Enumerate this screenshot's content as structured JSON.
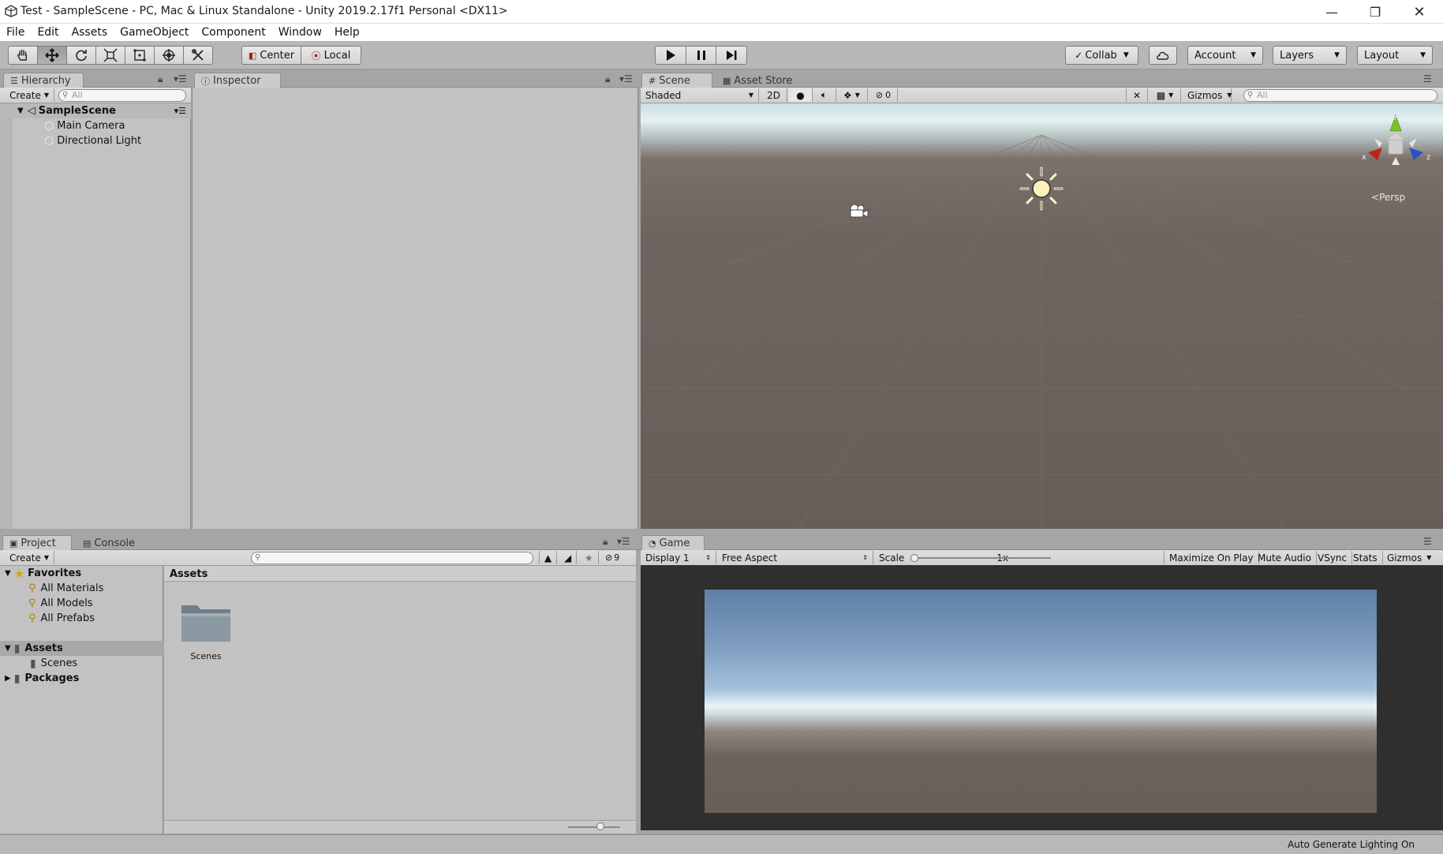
{
  "window": {
    "title": "Test - SampleScene - PC, Mac & Linux Standalone - Unity 2019.2.17f1 Personal <DX11>"
  },
  "menu": [
    "File",
    "Edit",
    "Assets",
    "GameObject",
    "Component",
    "Window",
    "Help"
  ],
  "toolbar": {
    "tools": [
      "hand-tool",
      "move-tool",
      "rotate-tool",
      "scale-tool",
      "rect-tool",
      "transform-tool",
      "custom-tool"
    ],
    "active_tool": "move-tool",
    "pivot_label": "Center",
    "space_label": "Local",
    "collab_label": "Collab",
    "account_label": "Account",
    "layers_label": "Layers",
    "layout_label": "Layout"
  },
  "hierarchy": {
    "tab_label": "Hierarchy",
    "create_label": "Create",
    "search_placeholder": "All",
    "scene_name": "SampleScene",
    "items": [
      "Main Camera",
      "Directional Light"
    ]
  },
  "inspector": {
    "tab_label": "Inspector"
  },
  "scene": {
    "tab_label": "Scene",
    "asset_store_label": "Asset Store",
    "shading_mode": "Shaded",
    "mode_2d_label": "2D",
    "hidden_count": "0",
    "gizmos_label": "Gizmos",
    "search_placeholder": "All",
    "axis_x": "x",
    "axis_y": "y",
    "axis_z": "z",
    "persp_label": "Persp"
  },
  "project": {
    "tab_label": "Project",
    "console_label": "Console",
    "create_label": "Create",
    "hidden_count": "9",
    "favorites_label": "Favorites",
    "favorites": [
      "All Materials",
      "All Models",
      "All Prefabs"
    ],
    "assets_label": "Assets",
    "asset_children": [
      "Scenes"
    ],
    "packages_label": "Packages",
    "breadcrumb": "Assets",
    "grid_items": [
      "Scenes"
    ]
  },
  "game": {
    "tab_label": "Game",
    "display_label": "Display 1",
    "aspect_label": "Free Aspect",
    "scale_label": "Scale",
    "scale_value": "1x",
    "scale_fraction": 0,
    "maximize_label": "Maximize On Play",
    "mute_label": "Mute Audio",
    "vsync_label": "VSync",
    "stats_label": "Stats",
    "gizmos_label": "Gizmos"
  },
  "status": {
    "text": "Auto Generate Lighting On"
  },
  "colors": {
    "editor_bg": "#c2c2c2",
    "toolbar_bg": "#b7b7b7",
    "selection": "#a8a8a8"
  }
}
